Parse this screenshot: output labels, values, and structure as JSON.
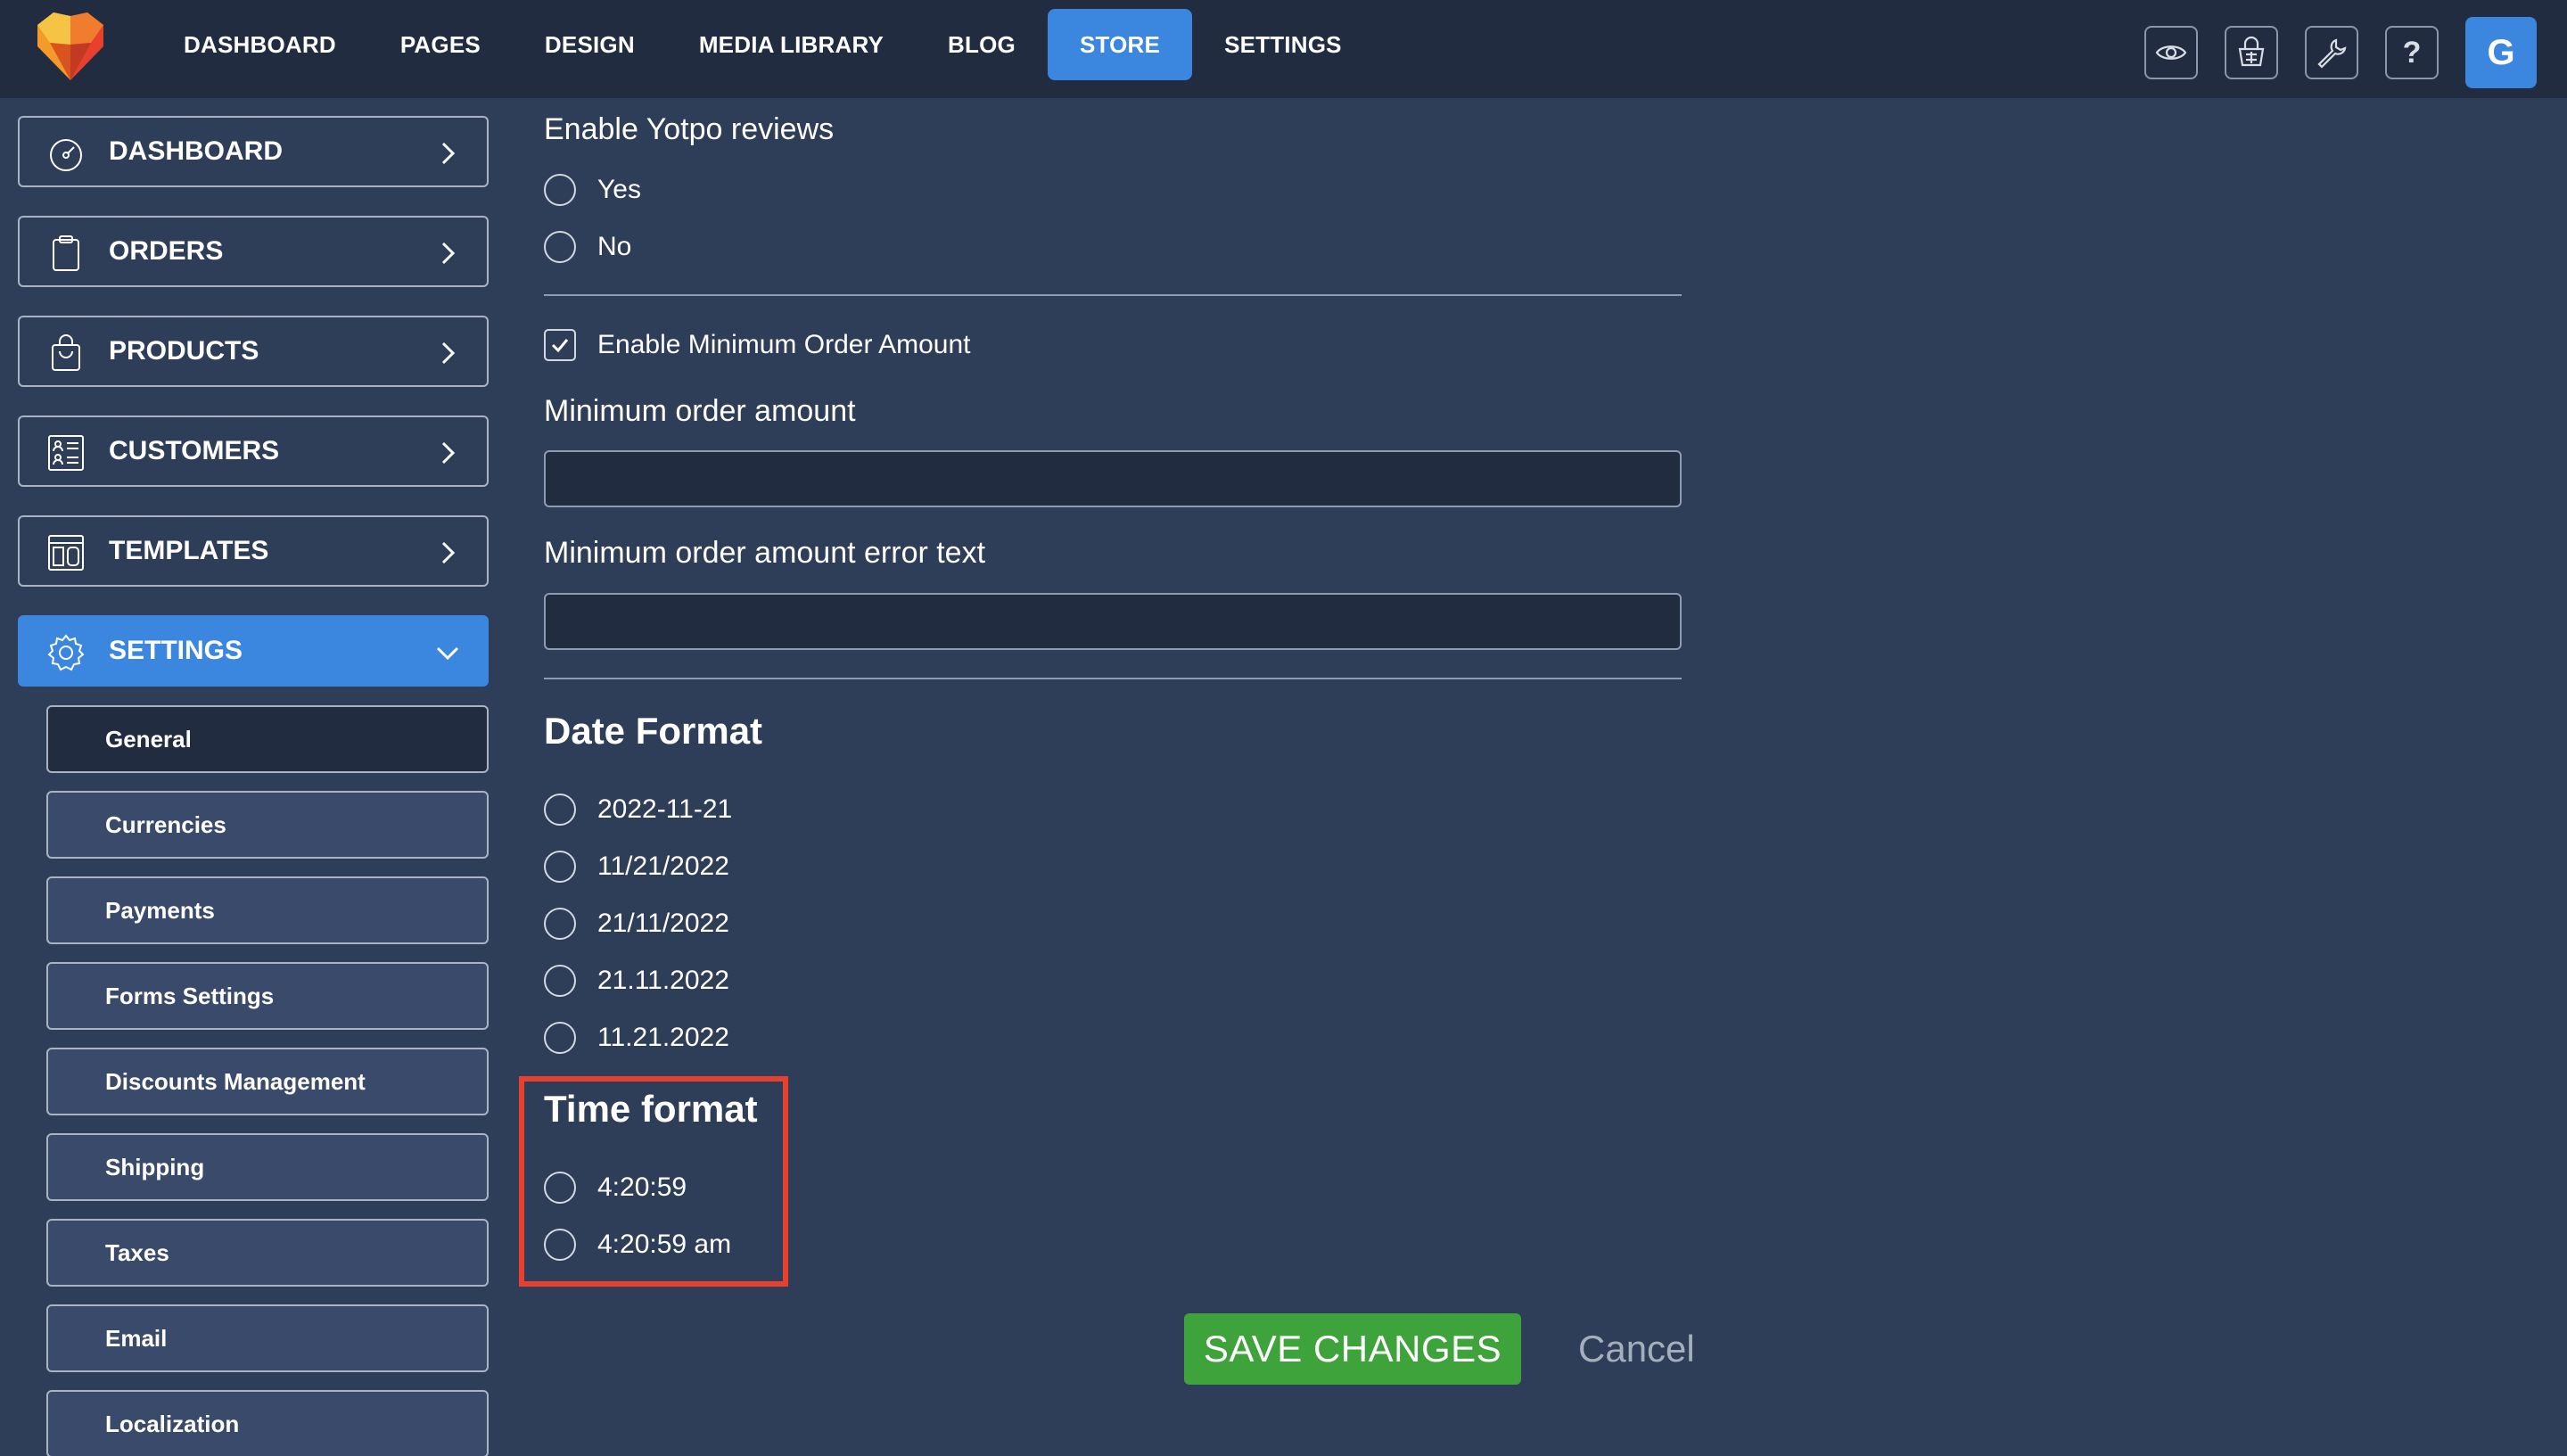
{
  "colors": {
    "topbar_bg": "#222c40",
    "page_bg": "#2e3d58",
    "accent_blue": "#3b86de",
    "save_green": "#3ea33a",
    "highlight_red": "#e8402e"
  },
  "topnav": {
    "items": [
      {
        "label": "DASHBOARD",
        "active": false
      },
      {
        "label": "PAGES",
        "active": false
      },
      {
        "label": "DESIGN",
        "active": false
      },
      {
        "label": "MEDIA LIBRARY",
        "active": false
      },
      {
        "label": "BLOG",
        "active": false
      },
      {
        "label": "STORE",
        "active": true
      },
      {
        "label": "SETTINGS",
        "active": false
      }
    ],
    "icons": [
      "eye-icon",
      "shopping-basket-icon",
      "wrench-icon",
      "help-icon"
    ],
    "help_glyph": "?",
    "avatar_letter": "G"
  },
  "sidebar": {
    "items": [
      {
        "label": "DASHBOARD",
        "icon": "gauge-icon"
      },
      {
        "label": "ORDERS",
        "icon": "clipboard-icon"
      },
      {
        "label": "PRODUCTS",
        "icon": "shopping-bag-icon"
      },
      {
        "label": "CUSTOMERS",
        "icon": "contacts-icon"
      },
      {
        "label": "TEMPLATES",
        "icon": "layout-icon"
      },
      {
        "label": "SETTINGS",
        "icon": "gear-icon",
        "active": true
      }
    ],
    "sub_items": [
      {
        "label": "General",
        "active": true
      },
      {
        "label": "Currencies"
      },
      {
        "label": "Payments"
      },
      {
        "label": "Forms Settings"
      },
      {
        "label": "Discounts Management"
      },
      {
        "label": "Shipping"
      },
      {
        "label": "Taxes"
      },
      {
        "label": "Email"
      },
      {
        "label": "Localization"
      }
    ]
  },
  "form": {
    "yotpo_label": "Enable Yotpo reviews",
    "yotpo_options": [
      "Yes",
      "No"
    ],
    "min_order_checkbox_label": "Enable Minimum Order Amount",
    "min_order_checked": true,
    "min_order_amount_label": "Minimum order amount",
    "min_order_amount_value": "",
    "min_order_error_label": "Minimum order amount error text",
    "min_order_error_value": "",
    "date_format_heading": "Date Format",
    "date_formats": [
      "2022-11-21",
      "11/21/2022",
      "21/11/2022",
      "21.11.2022",
      "11.21.2022"
    ],
    "time_format_heading": "Time format",
    "time_formats": [
      "4:20:59",
      "4:20:59 am"
    ],
    "save_label": "SAVE CHANGES",
    "cancel_label": "Cancel"
  }
}
